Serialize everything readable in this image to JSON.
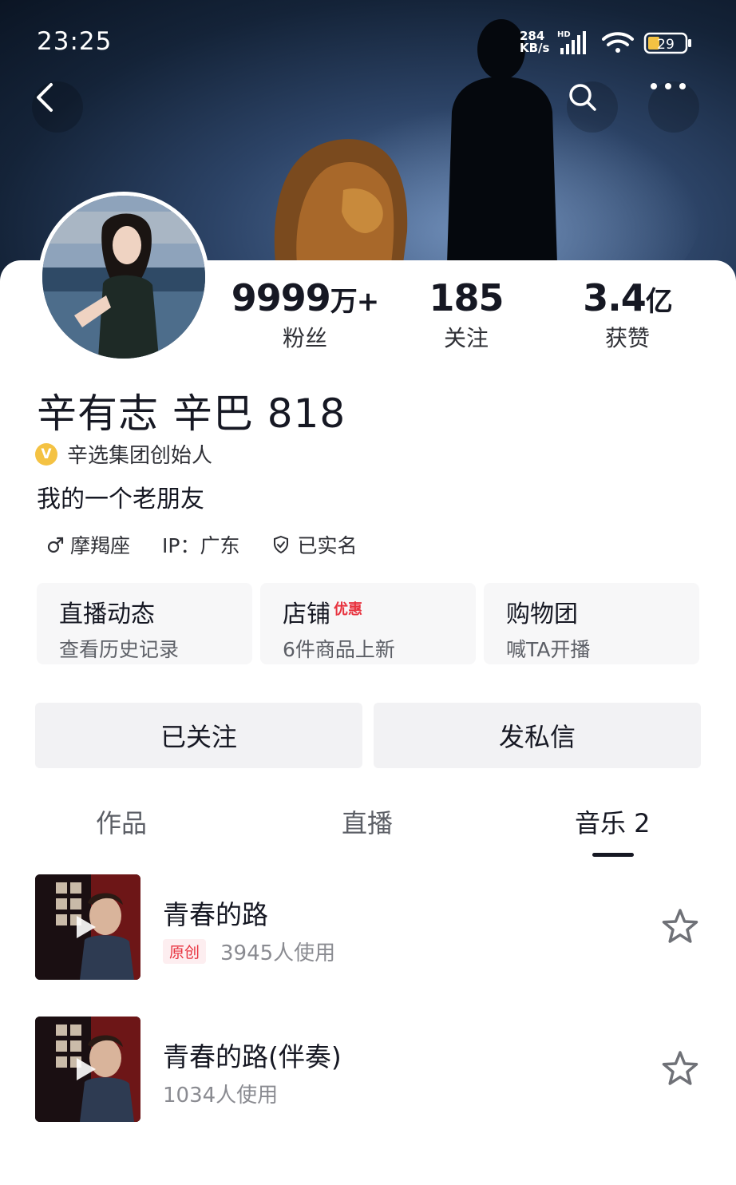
{
  "status_bar": {
    "time": "23:25",
    "speed_value": "284",
    "speed_unit": "KB/s",
    "network": "HD",
    "battery": "29"
  },
  "nav": {
    "back_icon": "chevron-left-icon",
    "search_icon": "search-icon",
    "more_icon": "more-dots-icon"
  },
  "profile": {
    "stats": [
      {
        "value": "9999",
        "unit": "万+",
        "label": "粉丝"
      },
      {
        "value": "185",
        "unit": "",
        "label": "关注"
      },
      {
        "value": "3.4",
        "unit": "亿",
        "label": "获赞"
      }
    ],
    "username": "辛有志 辛巴 818",
    "verify_badge": "V",
    "verify_text": "辛选集团创始人",
    "bio": "我的一个老朋友",
    "tags": {
      "zodiac": "摩羯座",
      "ip": "IP：广东",
      "real_name": "已实名"
    }
  },
  "features": [
    {
      "title": "直播动态",
      "badge": "",
      "sub": "查看历史记录"
    },
    {
      "title": "店铺",
      "badge": "优惠",
      "sub": "6件商品上新"
    },
    {
      "title": "购物团",
      "badge": "",
      "sub": "喊TA开播"
    }
  ],
  "actions": {
    "followed_label": "已关注",
    "message_label": "发私信"
  },
  "tabs": {
    "works": "作品",
    "live": "直播",
    "music": "音乐 2"
  },
  "songs": [
    {
      "title": "青春的路",
      "original_tag": "原创",
      "usage": "3945人使用"
    },
    {
      "title": "青春的路(伴奏)",
      "original_tag": "",
      "usage": "1034人使用"
    }
  ],
  "colors": {
    "accent_red": "#e8333f",
    "verify_gold": "#f4c243",
    "text_primary": "#161823"
  }
}
